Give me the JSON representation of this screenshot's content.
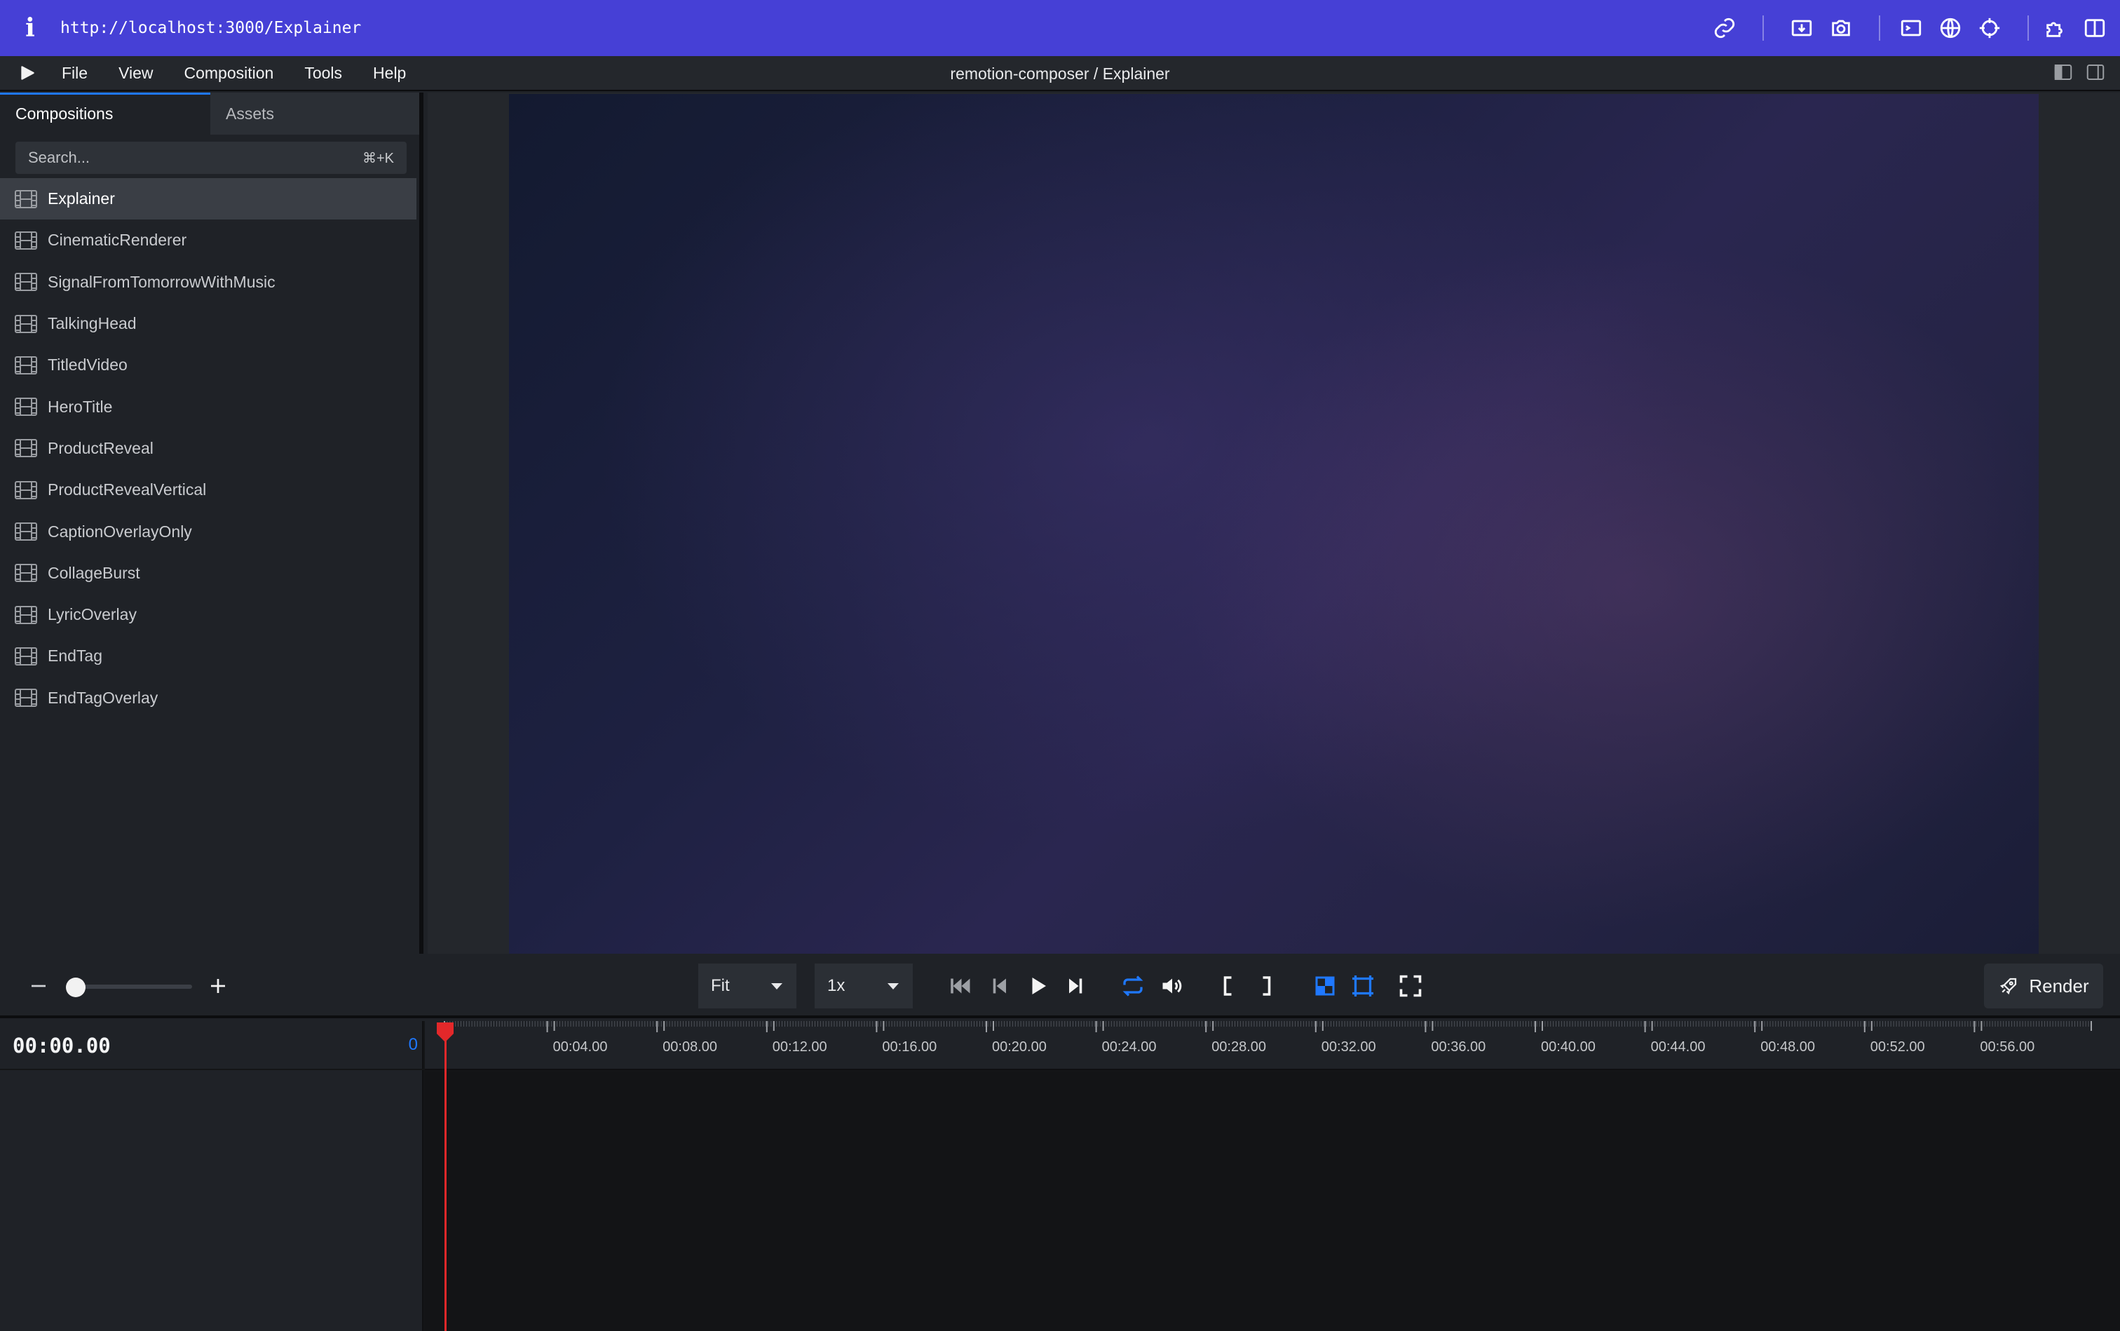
{
  "browser": {
    "info_glyph": "i",
    "url": "http://localhost:3000/Explainer",
    "icons": [
      "link-icon",
      "download-icon",
      "camera-icon",
      "terminal-icon",
      "globe-icon",
      "crosshair-icon",
      "puzzle-icon",
      "sidebar-toggle-icon"
    ]
  },
  "menubar": {
    "items": [
      "File",
      "View",
      "Composition",
      "Tools",
      "Help"
    ],
    "title": "remotion-composer / Explainer"
  },
  "sidebar": {
    "tabs": [
      "Compositions",
      "Assets"
    ],
    "search": {
      "placeholder": "Search...",
      "shortcut": "⌘+K"
    },
    "compositions": [
      "Explainer",
      "CinematicRenderer",
      "SignalFromTomorrowWithMusic",
      "TalkingHead",
      "TitledVideo",
      "HeroTitle",
      "ProductReveal",
      "ProductRevealVertical",
      "CaptionOverlayOnly",
      "CollageBurst",
      "LyricOverlay",
      "EndTag",
      "EndTagOverlay"
    ],
    "selected": "Explainer"
  },
  "controls": {
    "size_select": "Fit",
    "speed_select": "1x",
    "render_label": "Render",
    "zoom_level": 0
  },
  "timeline": {
    "timecode": "00:00.00",
    "frame": "0",
    "ticks": [
      "00:04.00",
      "00:08.00",
      "00:12.00",
      "00:16.00",
      "00:20.00",
      "00:24.00",
      "00:28.00",
      "00:32.00",
      "00:36.00",
      "00:40.00",
      "00:44.00",
      "00:48.00",
      "00:52.00",
      "00:56.00"
    ]
  },
  "colors": {
    "browser_bar": "#4640d6",
    "accent_blue": "#1f78ff",
    "playhead_red": "#e3282a",
    "panel_bg": "#1f2227"
  }
}
